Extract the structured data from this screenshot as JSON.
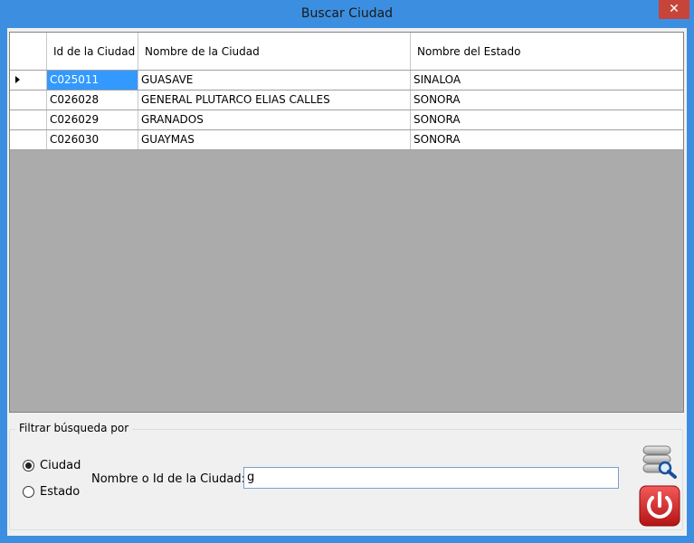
{
  "window": {
    "title": "Buscar Ciudad",
    "close_glyph": "✕"
  },
  "grid": {
    "columns": [
      "Id de la Ciudad",
      "Nombre de la Ciudad",
      "Nombre del Estado"
    ],
    "rows": [
      {
        "id": "C025011",
        "ciudad": "GUASAVE",
        "estado": "SINALOA"
      },
      {
        "id": "C026028",
        "ciudad": "GENERAL PLUTARCO ELIAS CALLES",
        "estado": "SONORA"
      },
      {
        "id": "C026029",
        "ciudad": "GRANADOS",
        "estado": "SONORA"
      },
      {
        "id": "C026030",
        "ciudad": "GUAYMAS",
        "estado": "SONORA"
      }
    ]
  },
  "filter": {
    "group_title": "Filtrar búsqueda por",
    "option_ciudad": "Ciudad",
    "option_estado": "Estado",
    "selected": "Ciudad",
    "field_label": "Nombre o Id de la Ciudad:",
    "field_value": "g"
  },
  "icons": {
    "search": "search-database-icon",
    "exit": "power-icon"
  },
  "colors": {
    "titlebar": "#3c8fe0",
    "selection": "#3399ff",
    "close": "#c7443a",
    "power": "#d42a2a"
  }
}
